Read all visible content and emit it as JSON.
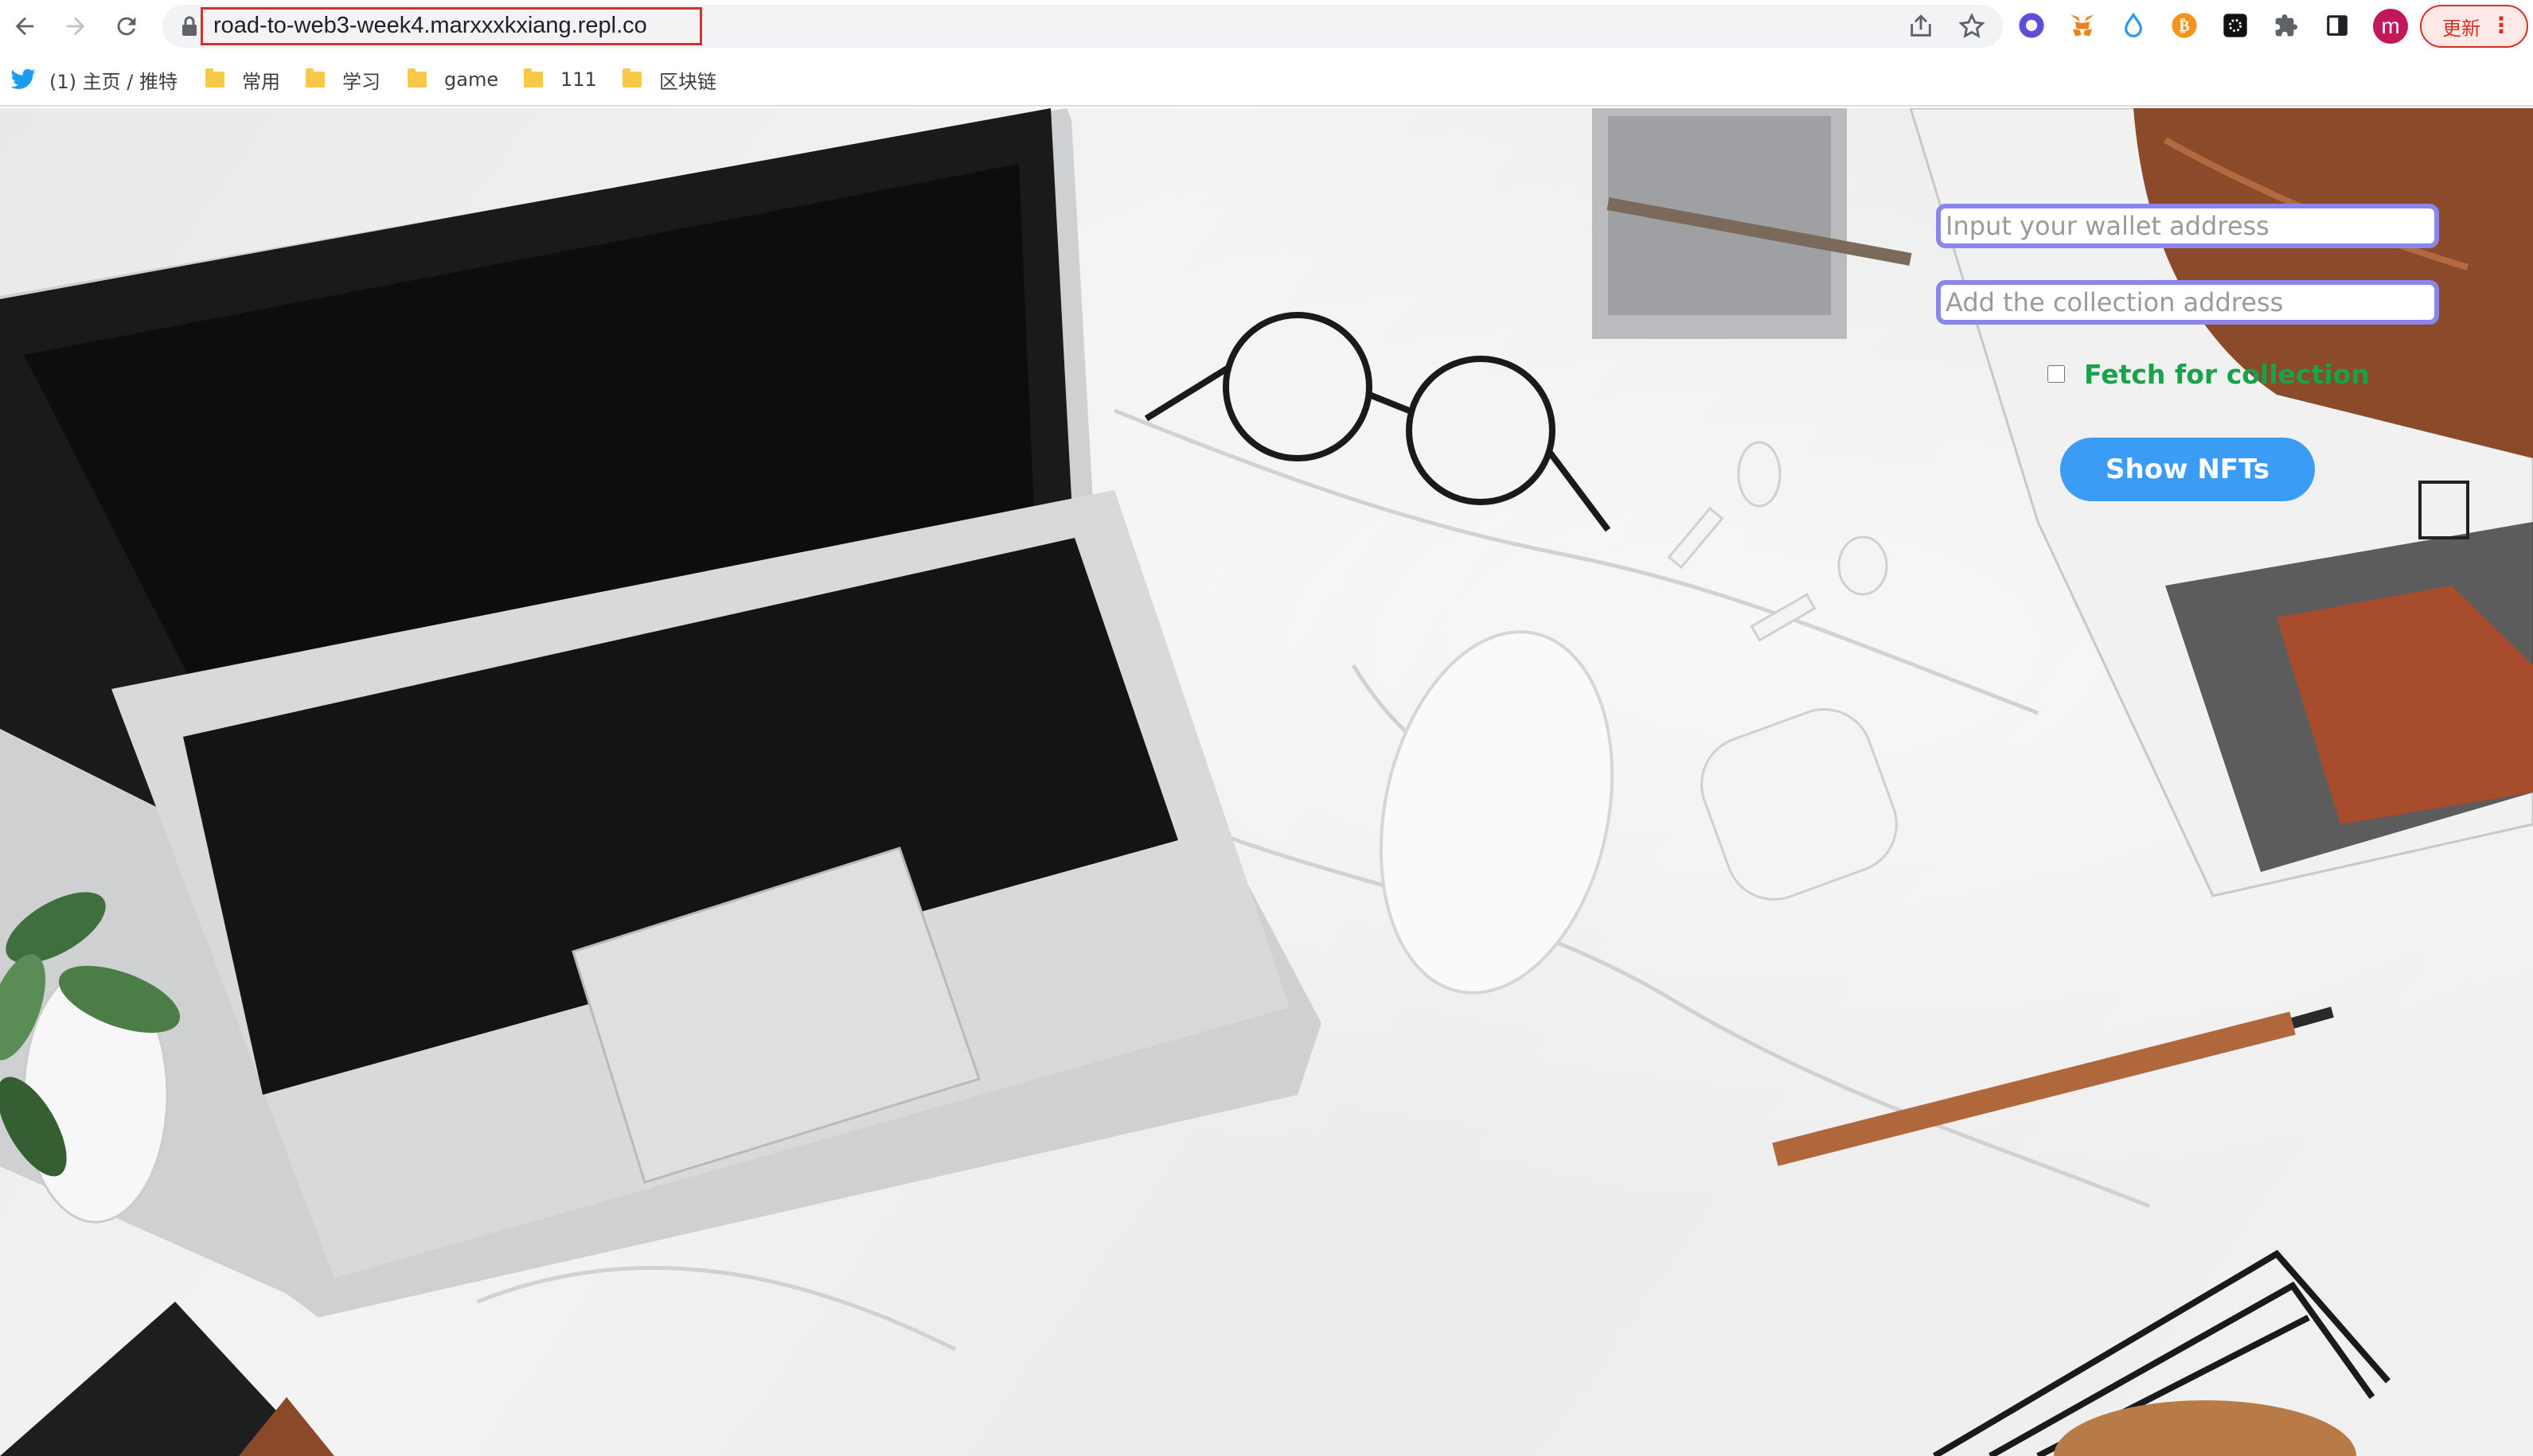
{
  "browser": {
    "url": "road-to-web3-week4.marxxxkxiang.repl.co",
    "update_label": "更新",
    "profile_initial": "m",
    "extensions": [
      "profile-circle-icon",
      "metamask-fox-icon",
      "water-drop-icon",
      "bitcoin-icon",
      "dark-app-icon",
      "puzzle-extensions-icon",
      "side-panel-icon"
    ]
  },
  "bookmarks": [
    {
      "label": "(1) 主页 / 推特",
      "icon": "twitter-bird-icon"
    },
    {
      "label": "常用",
      "icon": "folder-icon"
    },
    {
      "label": "学习",
      "icon": "folder-icon"
    },
    {
      "label": "game",
      "icon": "folder-icon"
    },
    {
      "label": "111",
      "icon": "folder-icon"
    },
    {
      "label": "区块链",
      "icon": "folder-icon"
    }
  ],
  "form": {
    "wallet_placeholder": "Input your wallet address",
    "wallet_value": "",
    "collection_placeholder": "Add the collection address",
    "collection_value": "",
    "fetch_label": "Fetch for collection",
    "fetch_checked": false,
    "show_button": "Show NFTs"
  },
  "colors": {
    "input_border": "#8b85ec",
    "fetch_label": "#16a34a",
    "button_bg": "#3b9cf5",
    "url_highlight": "#d93025"
  }
}
